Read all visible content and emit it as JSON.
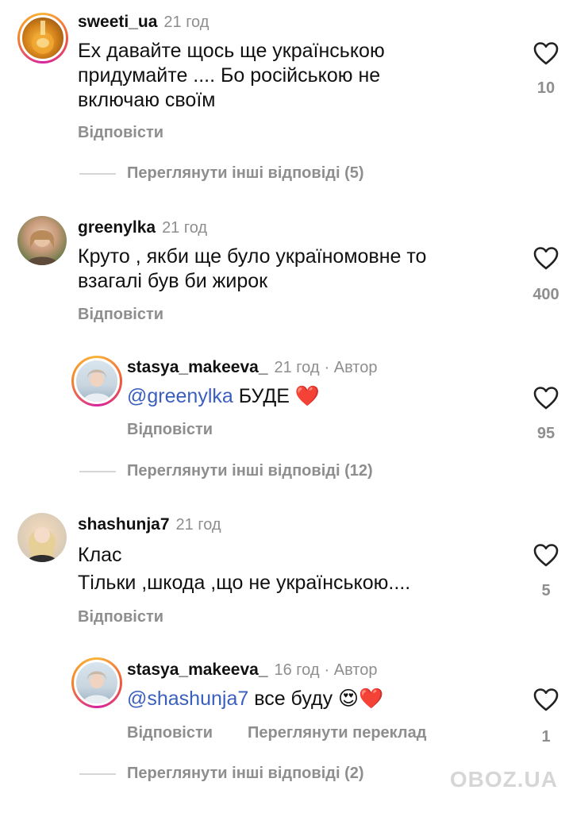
{
  "comments": [
    {
      "username": "sweeti_ua",
      "time": "21 год",
      "lines": [
        "Ех давайте щось ще українською",
        "придумайте .... Бо російською не",
        "включаю своїм"
      ],
      "reply_label": "Відповісти",
      "likes": "10",
      "view_replies": "Переглянути інші відповіді (5)"
    },
    {
      "username": "greenylka",
      "time": "21 год",
      "lines": [
        "Круто , якби ще було україномовне то",
        "взагалі був би жирок"
      ],
      "reply_label": "Відповісти",
      "likes": "400",
      "reply": {
        "username": "stasya_makeeva_",
        "time": "21 год",
        "author_badge": "· Автор",
        "mention": "@greenylka",
        "text": " БУДЕ",
        "emoji": "❤️",
        "reply_label": "Відповісти",
        "likes": "95"
      },
      "view_replies": "Переглянути інші відповіді (12)"
    },
    {
      "username": "shashunja7",
      "time": "21 год",
      "lines": [
        "Клас",
        "Тільки ,шкода ,що не українською...."
      ],
      "reply_label": "Відповісти",
      "likes": "5",
      "reply": {
        "username": "stasya_makeeva_",
        "time": "16 год",
        "author_badge": "· Автор",
        "mention": "@shashunja7",
        "text": " все буду",
        "emoji": "😍❤️",
        "reply_label": "Відповісти",
        "translate_label": "Переглянути переклад",
        "likes": "1"
      },
      "view_replies": "Переглянути інші відповіді (2)"
    }
  ],
  "watermark": "OBOZ.UA",
  "icons": {
    "like": "heart-outline-icon"
  },
  "colors": {
    "text": "#111111",
    "muted": "#8e8e8e",
    "mention": "#3a5fbf",
    "heart_red": "#e0201f"
  }
}
